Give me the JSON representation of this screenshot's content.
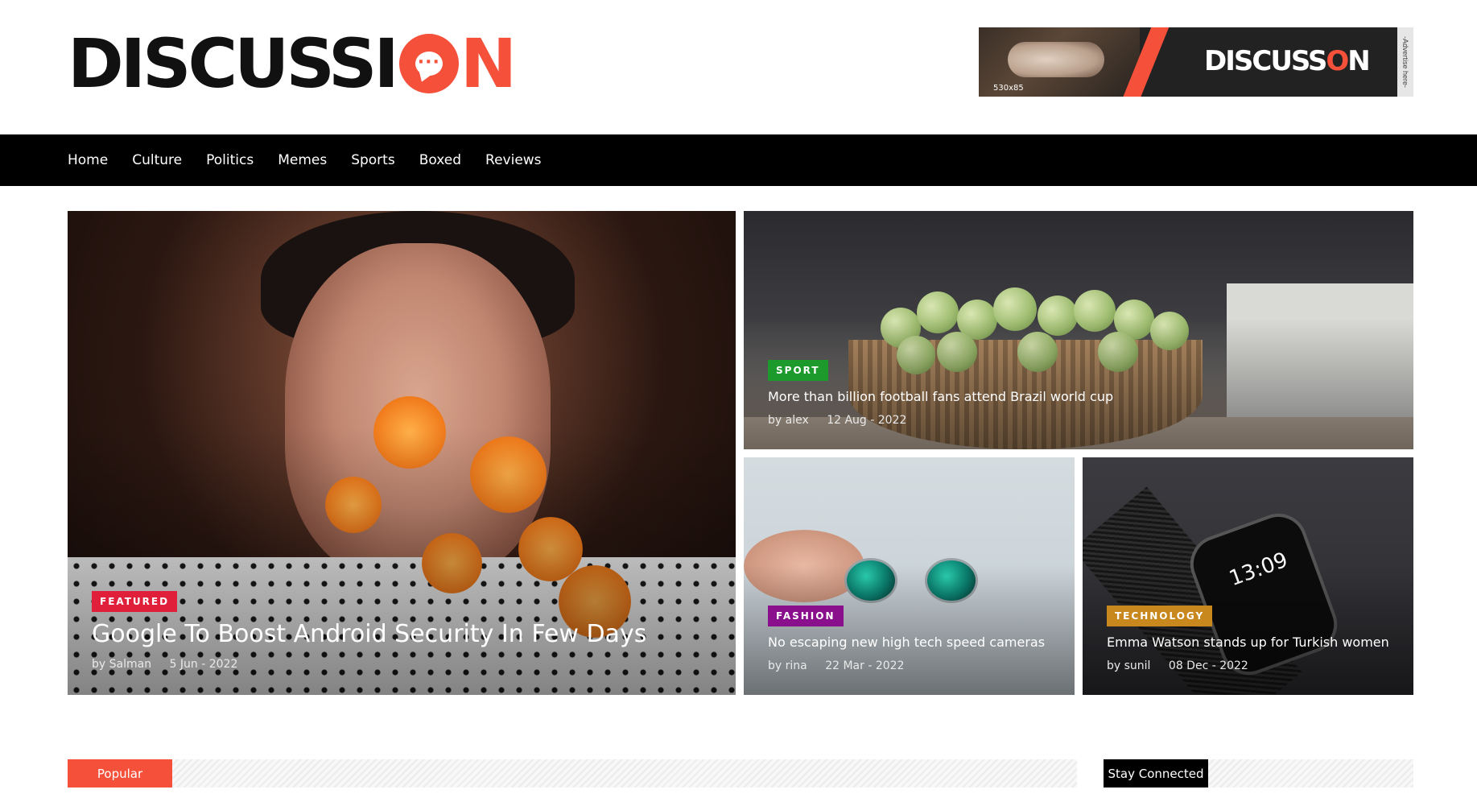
{
  "brand": {
    "logo_part1": "DISCUSSI",
    "logo_part2": "N",
    "logo_dots": "···",
    "accent_color": "#f4503a"
  },
  "ad": {
    "size_label": "530x85",
    "brand_part1": "DISCUSS",
    "brand_o": "O",
    "brand_part2": "N",
    "side_text": "-Advertise here-"
  },
  "nav": {
    "items": [
      "Home",
      "Culture",
      "Politics",
      "Memes",
      "Sports",
      "Boxed",
      "Reviews"
    ]
  },
  "posts": [
    {
      "category": "FEATURED",
      "category_color": "#e0203a",
      "title": "Google To Boost Android Security In Few Days",
      "author": "by Salman",
      "date": "5 Jun - 2022"
    },
    {
      "category": "SPORT",
      "category_color": "#1c9a2c",
      "title": "More than billion football fans attend Brazil world cup",
      "author": "by alex",
      "date": "12 Aug - 2022"
    },
    {
      "category": "FASHION",
      "category_color": "#8a0f8c",
      "title": "No escaping new high tech speed cameras",
      "author": "by rina",
      "date": "22 Mar - 2022"
    },
    {
      "category": "TECHNOLOGY",
      "category_color": "#c8881e",
      "title": "Emma Watson stands up for Turkish women",
      "author": "by sunil",
      "date": "08 Dec - 2022"
    }
  ],
  "watch_time": "13:09",
  "sections": {
    "popular": "Popular",
    "stay_connected": "Stay Connected"
  }
}
